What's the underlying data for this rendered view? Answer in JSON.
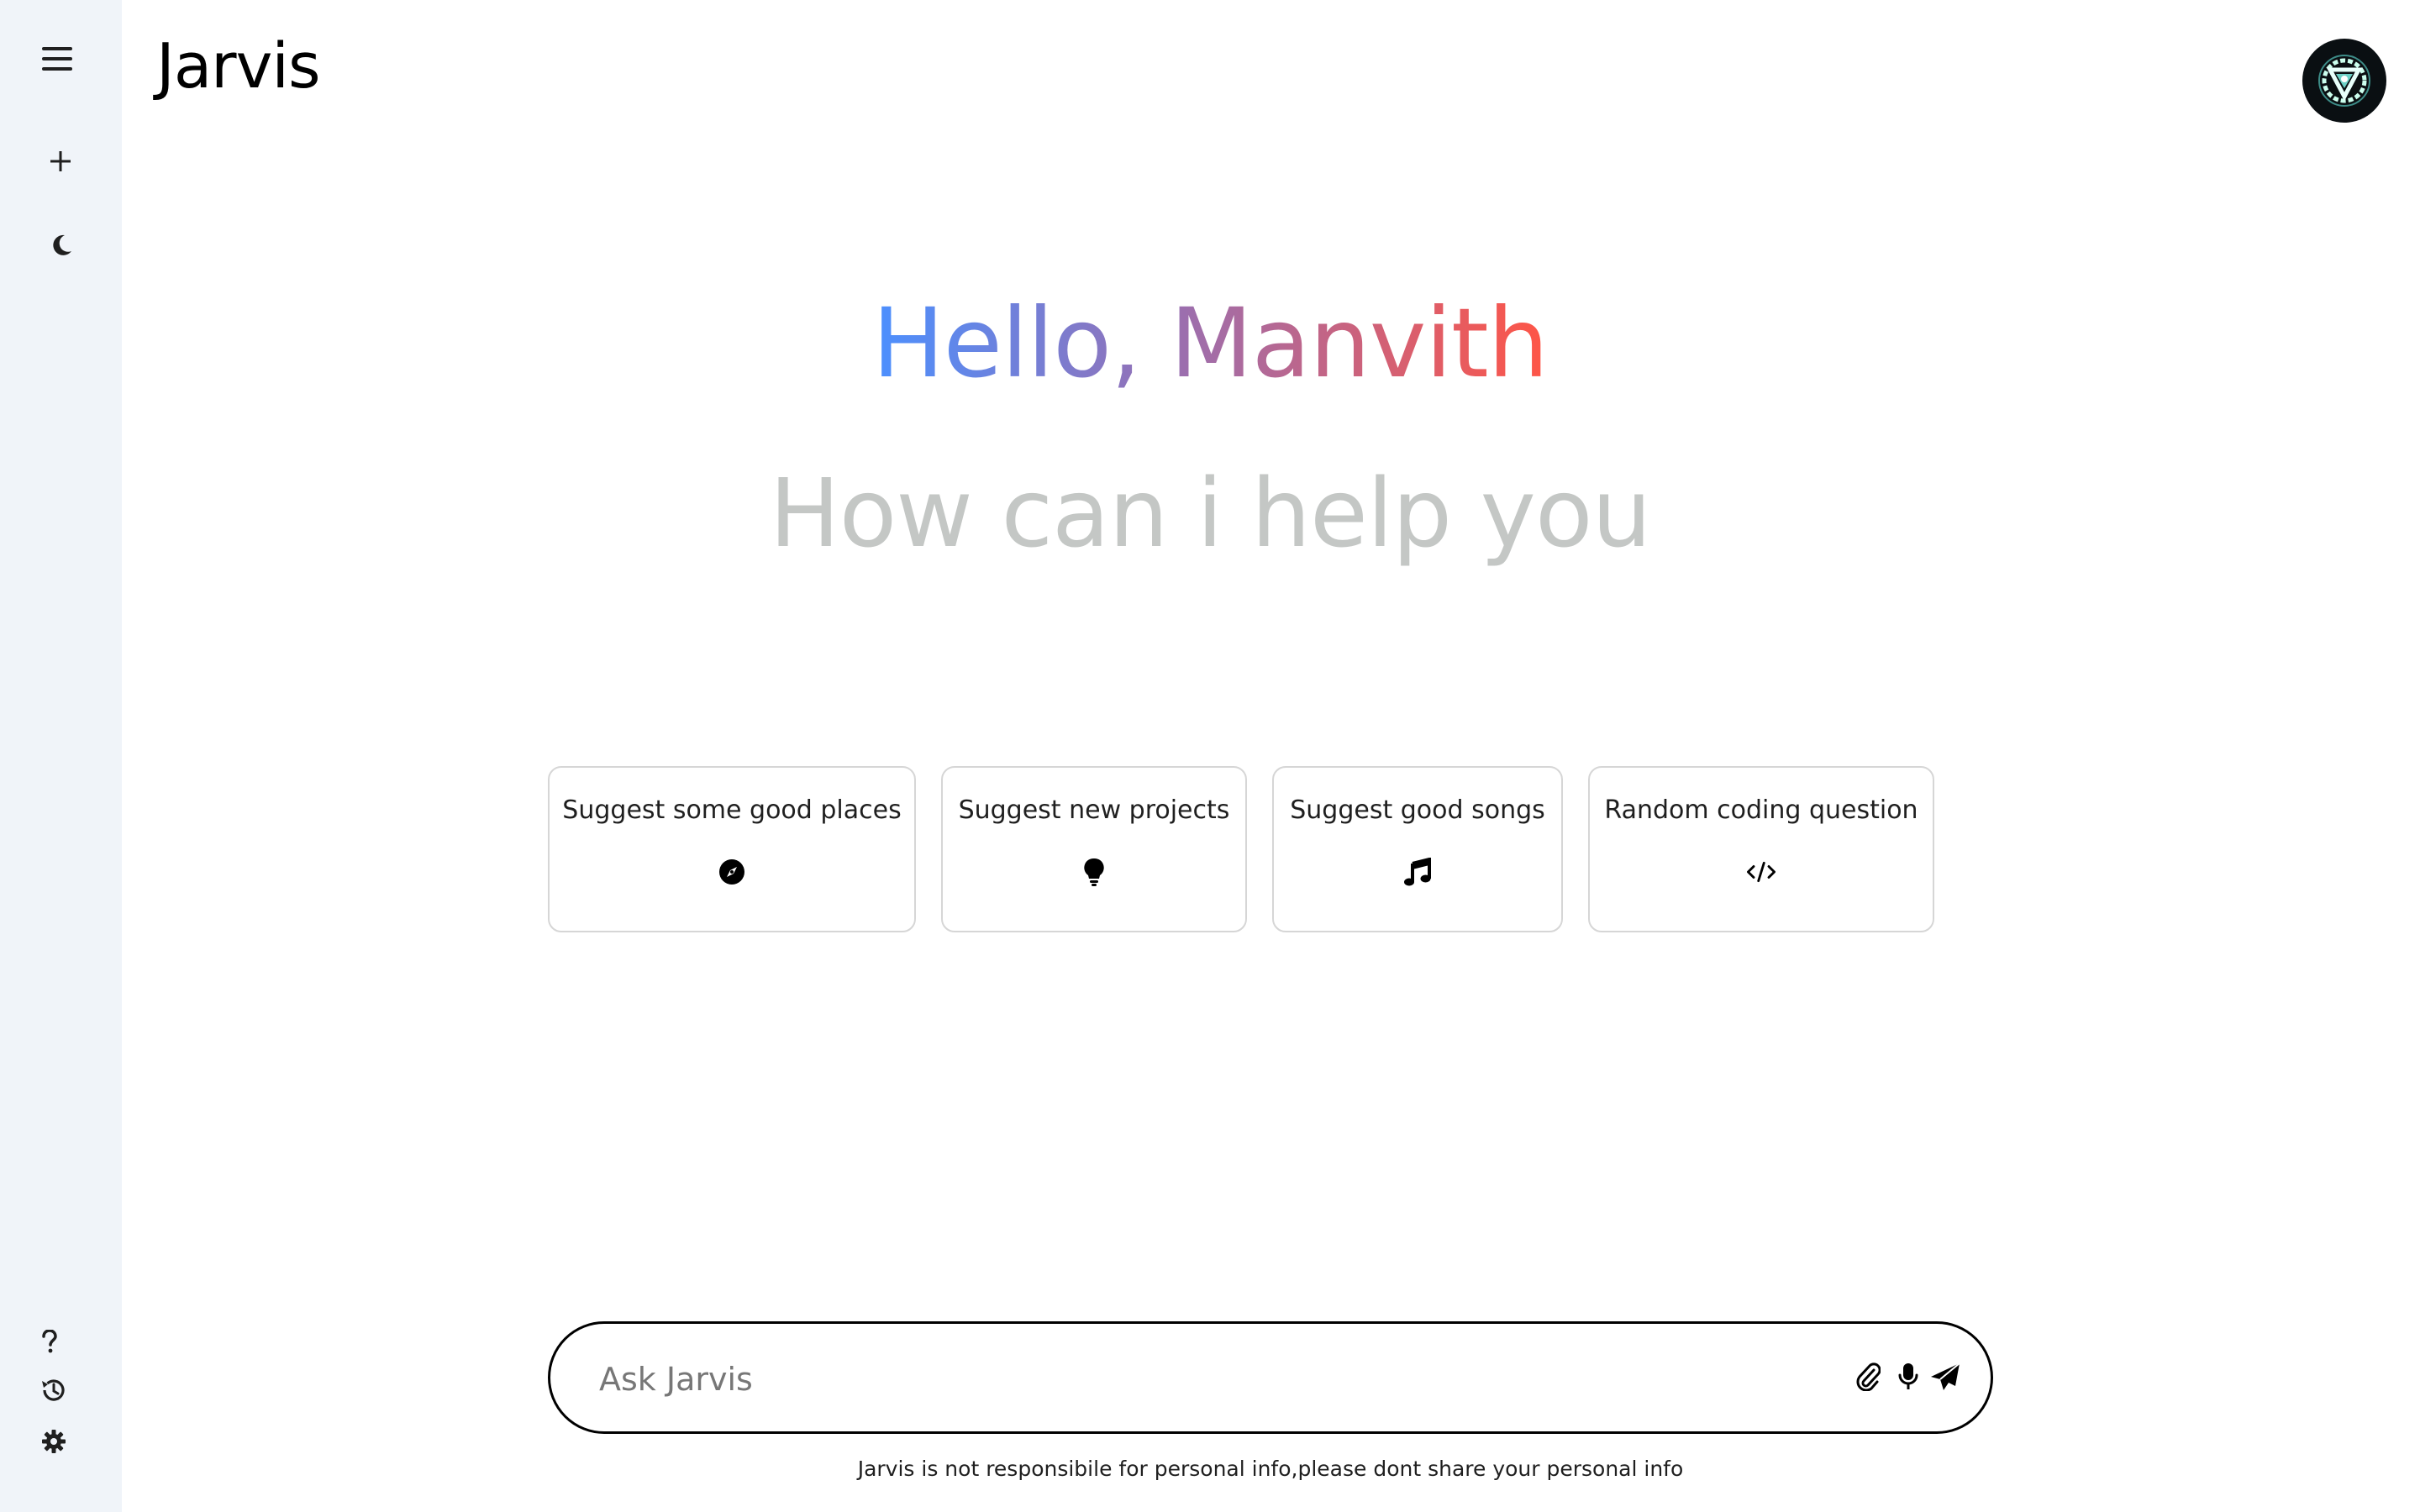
{
  "header": {
    "title": "Jarvis"
  },
  "sidebar": {
    "icons": [
      "menu-icon",
      "plus-icon",
      "moon-icon",
      "question-icon",
      "history-icon",
      "gear-icon"
    ]
  },
  "greeting": {
    "text": "Hello, Manvith",
    "gradient_start": "#4b90ff",
    "gradient_end": "#ff5546"
  },
  "subtitle": {
    "text": "How can i help you"
  },
  "cards": [
    {
      "label": "Suggest some good places",
      "icon": "compass-icon"
    },
    {
      "label": "Suggest new projects",
      "icon": "lightbulb-icon"
    },
    {
      "label": "Suggest good songs",
      "icon": "music-icon"
    },
    {
      "label": "Random coding question",
      "icon": "code-icon"
    }
  ],
  "prompt": {
    "placeholder": "Ask Jarvis",
    "value": "",
    "icons": [
      "paperclip-icon",
      "microphone-icon",
      "send-icon"
    ]
  },
  "footer": {
    "disclaimer": "Jarvis is not responsibile for personal info,please dont share your personal info"
  }
}
